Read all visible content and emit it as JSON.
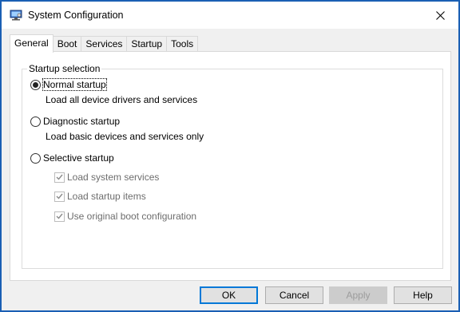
{
  "window": {
    "title": "System Configuration"
  },
  "tabs": [
    {
      "label": "General",
      "active": true
    },
    {
      "label": "Boot",
      "active": false
    },
    {
      "label": "Services",
      "active": false
    },
    {
      "label": "Startup",
      "active": false
    },
    {
      "label": "Tools",
      "active": false
    }
  ],
  "startup_selection": {
    "legend": "Startup selection",
    "options": [
      {
        "label": "Normal startup",
        "description": "Load all device drivers and services",
        "selected": true
      },
      {
        "label": "Diagnostic startup",
        "description": "Load basic devices and services only",
        "selected": false
      },
      {
        "label": "Selective startup",
        "selected": false
      }
    ],
    "selective_items": [
      {
        "label": "Load system services",
        "checked": true,
        "enabled": false
      },
      {
        "label": "Load startup items",
        "checked": true,
        "enabled": false
      },
      {
        "label": "Use original boot configuration",
        "checked": true,
        "enabled": false
      }
    ]
  },
  "buttons": {
    "ok": "OK",
    "cancel": "Cancel",
    "apply": "Apply",
    "help": "Help"
  },
  "icons": {
    "app": "system-configuration-icon",
    "close": "close-icon"
  },
  "colors": {
    "window_border": "#1a5fb4",
    "default_button_border": "#0078d7",
    "disabled_text": "#6d6d6d"
  }
}
